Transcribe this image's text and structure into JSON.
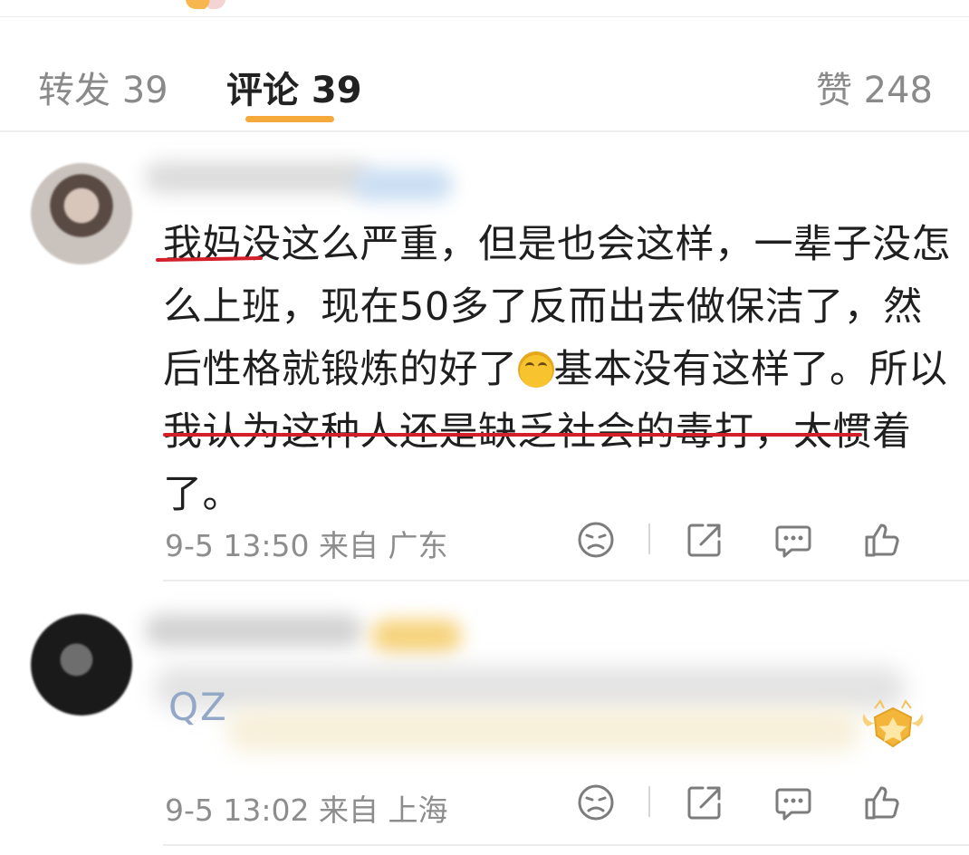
{
  "tabs": [
    {
      "label": "转发 39"
    },
    {
      "label": "评论 39"
    },
    {
      "label": "赞 248"
    }
  ],
  "comments": [
    {
      "text": "我妈没这么严重，但是也会这样，一辈子没怎么上班，现在50多了反而出去做保洁了，然后性格就锻炼的好了",
      "text_after_emoji": "基本没有这样了。所以我认为这种人还是缺乏社会的毒打，太惯着了。",
      "emoji": "laughing-crying-emoji",
      "time": "9-5 13:50",
      "location": "来自 广东"
    },
    {
      "text_fragment": "QZ",
      "time": "9-5 13:02",
      "location": "来自 上海"
    }
  ],
  "icons": [
    "dislike-face-icon",
    "share-icon",
    "comment-icon",
    "thumbs-up-icon",
    "medal-badge-icon"
  ],
  "colors": {
    "accent": "#f6a93b",
    "underline": "#d41f2a",
    "muted": "#8d8d8d"
  }
}
